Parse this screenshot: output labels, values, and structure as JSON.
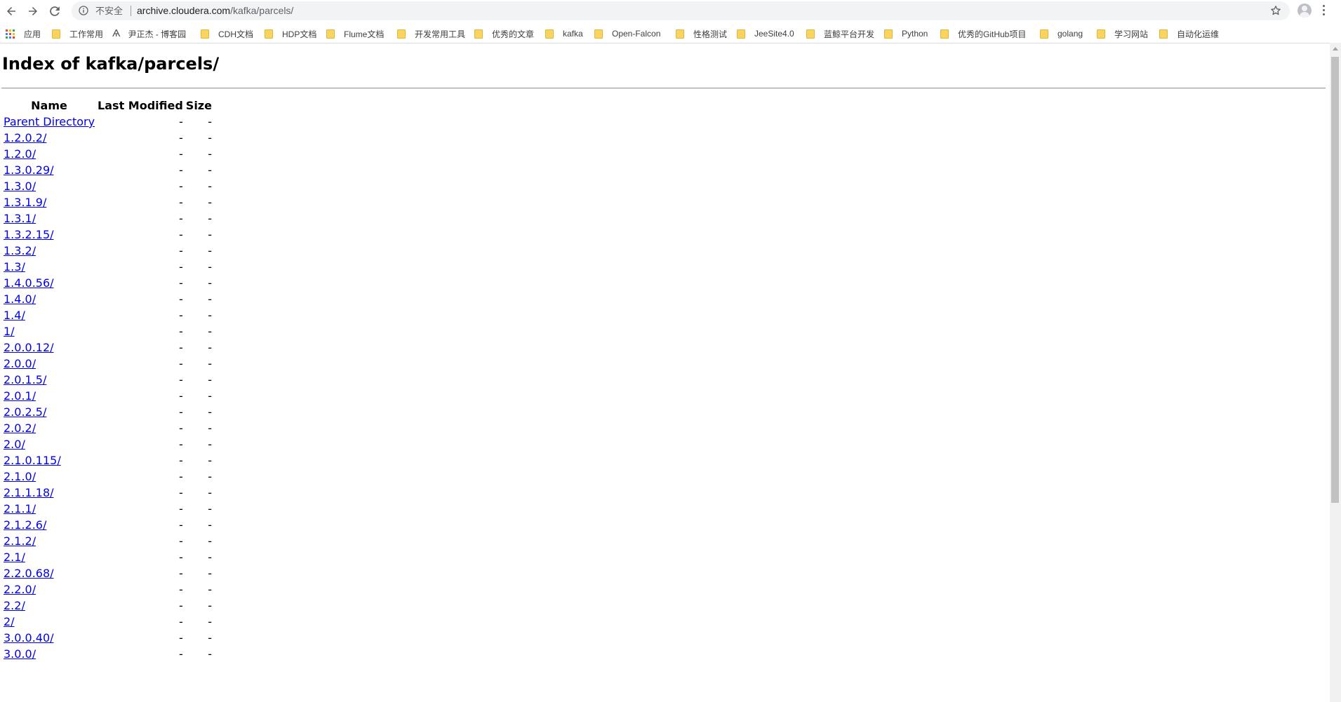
{
  "browser": {
    "security_label": "不安全",
    "url_host": "archive.cloudera.com",
    "url_path": "/kafka/parcels/"
  },
  "bookmarks": {
    "apps_label": "应用",
    "items": [
      "工作常用",
      "尹正杰 - 博客园",
      "CDH文档",
      "HDP文档",
      "Flume文档",
      "开发常用工具",
      "优秀的文章",
      "kafka",
      "Open-Falcon",
      "性格测试",
      "JeeSite4.0",
      "蓝鲸平台开发",
      "Python",
      "优秀的GitHub项目",
      "golang",
      "学习网站",
      "自动化运维"
    ]
  },
  "page": {
    "title": "Index of kafka/parcels/",
    "columns": [
      "Name",
      "Last Modified",
      "Size"
    ],
    "rows": [
      {
        "name": "Parent Directory",
        "modified": "-",
        "size": "-"
      },
      {
        "name": "1.2.0.2/",
        "modified": "-",
        "size": "-"
      },
      {
        "name": "1.2.0/",
        "modified": "-",
        "size": "-"
      },
      {
        "name": "1.3.0.29/",
        "modified": "-",
        "size": "-"
      },
      {
        "name": "1.3.0/",
        "modified": "-",
        "size": "-"
      },
      {
        "name": "1.3.1.9/",
        "modified": "-",
        "size": "-"
      },
      {
        "name": "1.3.1/",
        "modified": "-",
        "size": "-"
      },
      {
        "name": "1.3.2.15/",
        "modified": "-",
        "size": "-"
      },
      {
        "name": "1.3.2/",
        "modified": "-",
        "size": "-"
      },
      {
        "name": "1.3/",
        "modified": "-",
        "size": "-"
      },
      {
        "name": "1.4.0.56/",
        "modified": "-",
        "size": "-"
      },
      {
        "name": "1.4.0/",
        "modified": "-",
        "size": "-"
      },
      {
        "name": "1.4/",
        "modified": "-",
        "size": "-"
      },
      {
        "name": "1/",
        "modified": "-",
        "size": "-"
      },
      {
        "name": "2.0.0.12/",
        "modified": "-",
        "size": "-"
      },
      {
        "name": "2.0.0/",
        "modified": "-",
        "size": "-"
      },
      {
        "name": "2.0.1.5/",
        "modified": "-",
        "size": "-"
      },
      {
        "name": "2.0.1/",
        "modified": "-",
        "size": "-"
      },
      {
        "name": "2.0.2.5/",
        "modified": "-",
        "size": "-"
      },
      {
        "name": "2.0.2/",
        "modified": "-",
        "size": "-"
      },
      {
        "name": "2.0/",
        "modified": "-",
        "size": "-"
      },
      {
        "name": "2.1.0.115/",
        "modified": "-",
        "size": "-"
      },
      {
        "name": "2.1.0/",
        "modified": "-",
        "size": "-"
      },
      {
        "name": "2.1.1.18/",
        "modified": "-",
        "size": "-"
      },
      {
        "name": "2.1.1/",
        "modified": "-",
        "size": "-"
      },
      {
        "name": "2.1.2.6/",
        "modified": "-",
        "size": "-"
      },
      {
        "name": "2.1.2/",
        "modified": "-",
        "size": "-"
      },
      {
        "name": "2.1/",
        "modified": "-",
        "size": "-"
      },
      {
        "name": "2.2.0.68/",
        "modified": "-",
        "size": "-"
      },
      {
        "name": "2.2.0/",
        "modified": "-",
        "size": "-"
      },
      {
        "name": "2.2/",
        "modified": "-",
        "size": "-"
      },
      {
        "name": "2/",
        "modified": "-",
        "size": "-"
      },
      {
        "name": "3.0.0.40/",
        "modified": "-",
        "size": "-"
      },
      {
        "name": "3.0.0/",
        "modified": "-",
        "size": "-"
      }
    ]
  },
  "icons": {
    "back": "back-arrow-icon",
    "forward": "forward-arrow-icon",
    "reload": "reload-icon",
    "info": "info-icon",
    "star": "star-icon",
    "folder_color": "#f9d560",
    "link_color": "#0000ee"
  }
}
